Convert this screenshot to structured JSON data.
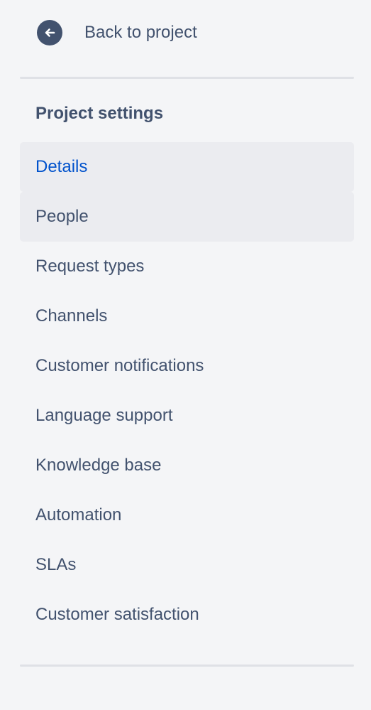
{
  "back": {
    "label": "Back to project",
    "icon": "arrow-left-circle-icon"
  },
  "section": {
    "title": "Project settings"
  },
  "nav": {
    "items": [
      {
        "label": "Details",
        "state": "active"
      },
      {
        "label": "People",
        "state": "hovered"
      },
      {
        "label": "Request types",
        "state": "default"
      },
      {
        "label": "Channels",
        "state": "default"
      },
      {
        "label": "Customer notifications",
        "state": "default"
      },
      {
        "label": "Language support",
        "state": "default"
      },
      {
        "label": "Knowledge base",
        "state": "default"
      },
      {
        "label": "Automation",
        "state": "default"
      },
      {
        "label": "SLAs",
        "state": "default"
      },
      {
        "label": "Customer satisfaction",
        "state": "default"
      }
    ]
  },
  "colors": {
    "background": "#f4f5f7",
    "text": "#42526e",
    "active_text": "#0052cc",
    "selected_background": "#ebecf0",
    "divider": "#dfe1e6"
  }
}
